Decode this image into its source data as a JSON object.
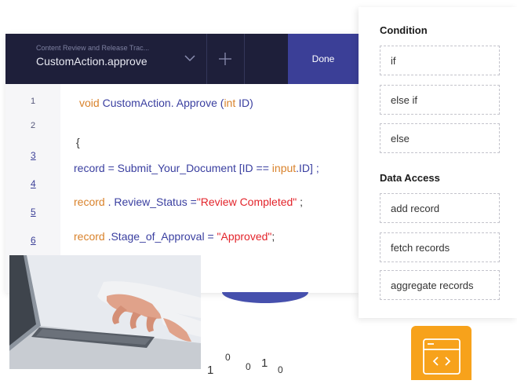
{
  "editor": {
    "subtitle": "Content Review and Release Trac...",
    "file_name": "CustomAction.approve",
    "done_label": "Done",
    "line_numbers": [
      "1",
      "2",
      "3",
      "4",
      "5",
      "6"
    ],
    "code": {
      "l1_kw": "void",
      "l1_fn": " CustomAction. Approve (",
      "l1_type": "int",
      "l1_rest": " ID)",
      "l2": "{",
      "l3_a": "record = Submit_Your_Document [ID == ",
      "l3_b": "input",
      "l3_c": ".ID] ;",
      "l4_a": "record",
      "l4_b": " . Review_Status =",
      "l4_str": "\"Review Completed\"",
      "l4_end": " ;",
      "l5_a": "record",
      "l5_b": " .Stage_of_Approval = ",
      "l5_str": "\"Approved\"",
      "l5_end": ";"
    }
  },
  "panel": {
    "condition_heading": "Condition",
    "condition_items": [
      "if",
      "else if",
      "else"
    ],
    "data_access_heading": "Data Access",
    "data_access_items": [
      "add record",
      "fetch records",
      "aggregate records"
    ]
  },
  "decor": {
    "digits": [
      "1",
      "0",
      "0",
      "1",
      "0"
    ]
  },
  "colors": {
    "topbar": "#1e1f3a",
    "done_button": "#3b3f97",
    "code_identifier": "#3a3fa0",
    "code_keyword": "#d9822b",
    "code_string": "#e3242b",
    "accent_orange": "#f7a21b"
  },
  "icons": [
    "chevron-down-icon",
    "plus-icon",
    "code-window-icon"
  ]
}
